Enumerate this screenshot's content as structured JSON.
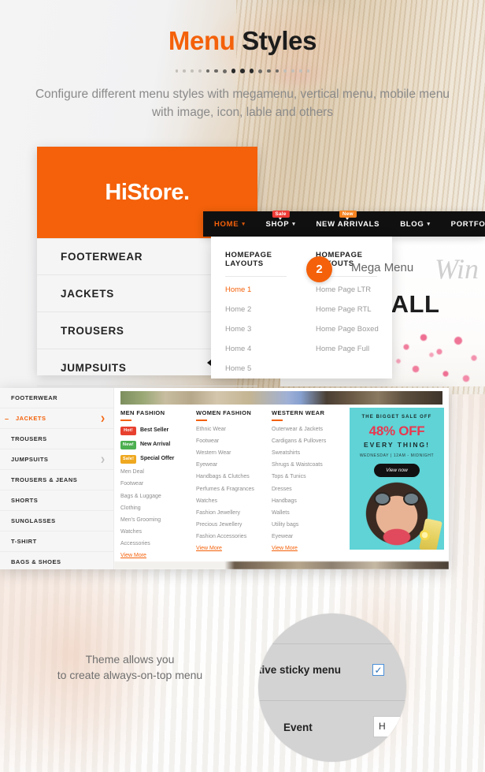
{
  "header": {
    "title_accent": "Menu",
    "title_rest": " Styles",
    "subtitle": "Configure different menu styles with megamenu, vertical menu, mobile menu with image, icon, lable and others",
    "accent_color": "#f4610a"
  },
  "vertical_menu": {
    "logo": "HiStore.",
    "items": [
      {
        "label": "FOOTERWEAR"
      },
      {
        "label": "JACKETS"
      },
      {
        "label": "TROUSERS"
      },
      {
        "label": "JUMPSUITS"
      }
    ]
  },
  "topnav": {
    "items": [
      {
        "label": "HOME",
        "caret": "⌄",
        "active": true,
        "badge": null
      },
      {
        "label": "SHOP",
        "caret": "⌄",
        "active": false,
        "badge": "Sale",
        "badge_type": "sale"
      },
      {
        "label": "NEW ARRIVALS",
        "caret": "",
        "active": false,
        "badge": "New",
        "badge_type": "new"
      },
      {
        "label": "BLOG",
        "caret": "⌄",
        "active": false,
        "badge": null
      },
      {
        "label": "PORTFOLIOS",
        "caret": "⌄",
        "active": false,
        "badge": null
      }
    ]
  },
  "dropdown": {
    "columns": [
      {
        "title": "HOMEPAGE LAYOUTS",
        "links": [
          "Home 1",
          "Home 2",
          "Home 3",
          "Home 4",
          "Home 5"
        ],
        "selected": "Home 1"
      },
      {
        "title": "HOMEPAGE LAYOUTS",
        "links": [
          "Home Page LTR",
          "Home Page RTL",
          "Home Page Boxed",
          "Home Page Full"
        ],
        "selected": ""
      }
    ]
  },
  "callout": {
    "number": "2",
    "label": "Mega Menu"
  },
  "fall_banner": {
    "script_text": "Win",
    "main_text": "NEW FALL"
  },
  "mega_menu": {
    "sidebar": [
      {
        "label": "FOOTERWEAR",
        "active": false,
        "chevron": false,
        "minus": false
      },
      {
        "label": "JACKETS",
        "active": true,
        "chevron": true,
        "minus": true
      },
      {
        "label": "TROUSERS",
        "active": false,
        "chevron": false,
        "minus": false
      },
      {
        "label": "JUMPSUITS",
        "active": false,
        "chevron": true,
        "minus": false
      },
      {
        "label": "TROUSERS & JEANS",
        "active": false,
        "chevron": false,
        "minus": false
      },
      {
        "label": "SHORTS",
        "active": false,
        "chevron": false,
        "minus": false
      },
      {
        "label": "SUNGLASSES",
        "active": false,
        "chevron": false,
        "minus": false
      },
      {
        "label": "T-SHIRT",
        "active": false,
        "chevron": false,
        "minus": false
      },
      {
        "label": "BAGS & SHOES",
        "active": false,
        "chevron": false,
        "minus": false
      }
    ],
    "columns": [
      {
        "title": "MEN FASHION",
        "items": [
          {
            "tag": "Hot!",
            "tag_type": "hot",
            "label": "Best Seller"
          },
          {
            "tag": "New!",
            "tag_type": "new",
            "label": "New Arrival"
          },
          {
            "tag": "Sale!",
            "tag_type": "sale",
            "label": "Special Offer"
          },
          {
            "tag": null,
            "label": "Men Deal"
          },
          {
            "tag": null,
            "label": "Footwear"
          },
          {
            "tag": null,
            "label": "Bags & Luggage"
          },
          {
            "tag": null,
            "label": "Clothing"
          },
          {
            "tag": null,
            "label": "Men's Grooming"
          },
          {
            "tag": null,
            "label": "Watches"
          },
          {
            "tag": null,
            "label": "Accessories"
          }
        ],
        "view_more": "View More"
      },
      {
        "title": "WOMEN FASHION",
        "items": [
          {
            "tag": null,
            "label": "Ethnic Wear"
          },
          {
            "tag": null,
            "label": "Footwear"
          },
          {
            "tag": null,
            "label": "Western Wear"
          },
          {
            "tag": null,
            "label": "Eyewear"
          },
          {
            "tag": null,
            "label": "Handbags & Clutches"
          },
          {
            "tag": null,
            "label": "Perfumes & Fragrances"
          },
          {
            "tag": null,
            "label": "Watches"
          },
          {
            "tag": null,
            "label": "Fashion Jewellery"
          },
          {
            "tag": null,
            "label": "Precious Jewellery"
          },
          {
            "tag": null,
            "label": "Fashion Accessories"
          }
        ],
        "view_more": "View More"
      },
      {
        "title": "WESTERN WEAR",
        "items": [
          {
            "tag": null,
            "label": "Outerwear & Jackets"
          },
          {
            "tag": null,
            "label": "Cardigans & Pullovers"
          },
          {
            "tag": null,
            "label": "Sweatshirts"
          },
          {
            "tag": null,
            "label": "Shrugs & Waistcoats"
          },
          {
            "tag": null,
            "label": "Tops & Tunics"
          },
          {
            "tag": null,
            "label": "Dresses"
          },
          {
            "tag": null,
            "label": "Handbags"
          },
          {
            "tag": null,
            "label": "Wallets"
          },
          {
            "tag": null,
            "label": "Utility bags"
          },
          {
            "tag": null,
            "label": "Eyewear"
          }
        ],
        "view_more": "View More"
      }
    ],
    "promo": {
      "line1": "THE BIGGET SALE OFF",
      "line2": "48% OFF",
      "line3": "EVERY THING!",
      "line4": "WEDNESDAY  |  12AM - MIDNIGHT",
      "button": "View now",
      "bg_color": "#5fd3d6",
      "accent_color": "#e8384f"
    }
  },
  "bottom": {
    "caption_line1": "Theme allows you",
    "caption_line2": "to create always-on-top menu",
    "magnifier": {
      "setting_label": "tive sticky menu",
      "checkbox_checked": "✓",
      "second_label": "Event",
      "field_value": "H"
    }
  }
}
